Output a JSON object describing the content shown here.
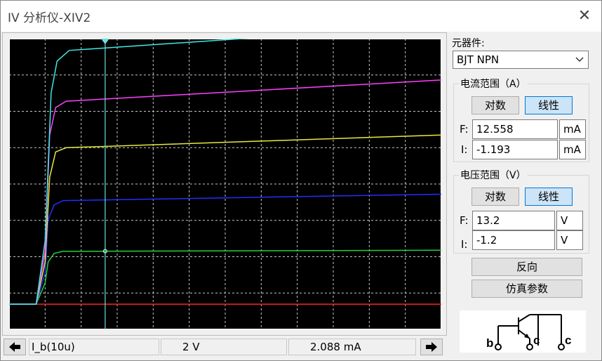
{
  "window": {
    "title": "IV 分析仪-XIV2",
    "close_glyph": "✕"
  },
  "device": {
    "label": "元器件:",
    "selected": "BJT NPN",
    "chevron_icon": "chevron-down-icon"
  },
  "current_range": {
    "title": "电流范围（A）",
    "log_label": "对数",
    "linear_label": "线性",
    "mode": "linear",
    "f_label": "F:",
    "f_value": "12.558",
    "f_unit": "mA",
    "i_label": "I:",
    "i_value": "-1.193",
    "i_unit": "mA"
  },
  "voltage_range": {
    "title": "电压范围（V）",
    "log_label": "对数",
    "linear_label": "线性",
    "mode": "linear",
    "f_label": "F:",
    "f_value": "13.2",
    "f_unit": "V",
    "i_label": "I:",
    "i_value": "-1.2",
    "i_unit": "V"
  },
  "buttons": {
    "reverse": "反向",
    "sim_params": "仿真参数"
  },
  "symbol": {
    "b": "b",
    "c1": "c",
    "c2": "c"
  },
  "status": {
    "left_arrow": "left-arrow-icon",
    "trace": "I_b(10u)",
    "voltage": "2  V",
    "current": "2.088 mA",
    "right_arrow": "right-arrow-icon"
  },
  "colors": {
    "plot_bg": "#000000",
    "grid": "#c8c8c8",
    "cursor": "#66e0e0",
    "series": [
      "#ff2020",
      "#22d040",
      "#2030ff",
      "#e8e840",
      "#ff40ff",
      "#40e8e8"
    ]
  },
  "chart_data": {
    "type": "line",
    "title": "",
    "xlabel": "",
    "ylabel": "",
    "x_unit": "V",
    "y_unit": "mA",
    "xlim": [
      -1.2,
      13.2
    ],
    "ylim": [
      -1.193,
      12.558
    ],
    "grid": true,
    "cursor_x": 2.0,
    "series": [
      {
        "x": [
          -1.2,
          13.2
        ],
        "y": [
          0.0,
          0.0
        ]
      },
      {
        "x": [
          -1.2,
          -0.3,
          0.0,
          0.1,
          0.3,
          0.6,
          13.2
        ],
        "y": [
          0.0,
          0.0,
          1.0,
          2.0,
          2.4,
          2.5,
          2.55
        ]
      },
      {
        "x": [
          -1.2,
          -0.3,
          0.0,
          0.1,
          0.3,
          0.6,
          13.2
        ],
        "y": [
          0.0,
          0.0,
          1.5,
          4.0,
          4.7,
          4.9,
          5.2
        ]
      },
      {
        "x": [
          -1.2,
          -0.3,
          0.0,
          0.15,
          0.35,
          0.7,
          13.2
        ],
        "y": [
          0.0,
          0.0,
          2.0,
          6.0,
          7.2,
          7.4,
          8.0
        ]
      },
      {
        "x": [
          -1.2,
          -0.3,
          0.0,
          0.15,
          0.35,
          0.7,
          13.2
        ],
        "y": [
          0.0,
          0.0,
          2.5,
          8.0,
          9.3,
          9.6,
          10.6
        ]
      },
      {
        "x": [
          -1.2,
          -0.3,
          0.0,
          0.2,
          0.4,
          0.8,
          13.2
        ],
        "y": [
          0.0,
          0.0,
          3.0,
          10.0,
          11.5,
          12.0,
          13.2
        ]
      }
    ]
  }
}
